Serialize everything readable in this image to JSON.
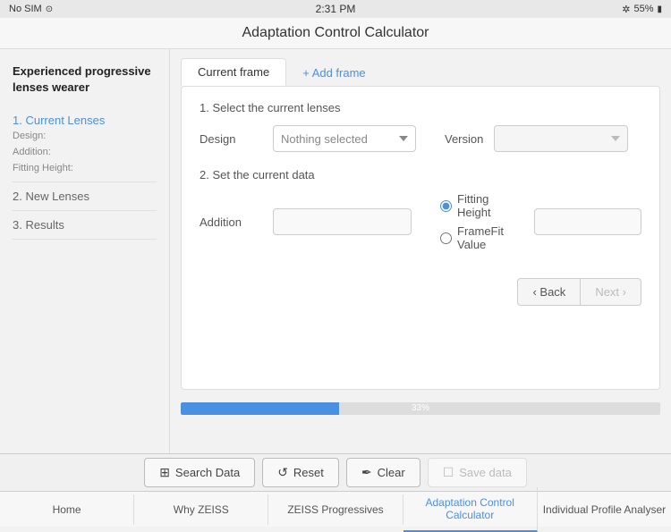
{
  "statusBar": {
    "carrier": "No SIM",
    "time": "2:31 PM",
    "battery": "55%",
    "wifi": true
  },
  "titleBar": {
    "title": "Adaptation Control Calculator"
  },
  "sidebar": {
    "title": "Experienced progressive lenses wearer",
    "items": [
      {
        "id": "current-lenses",
        "number": "1.",
        "label": "Current Lenses",
        "active": true,
        "subItems": [
          {
            "key": "Design:",
            "value": ""
          },
          {
            "key": "Addition:",
            "value": ""
          },
          {
            "key": "Fitting Height:",
            "value": ""
          }
        ]
      },
      {
        "id": "new-lenses",
        "number": "2.",
        "label": "New Lenses",
        "active": false
      },
      {
        "id": "results",
        "number": "3.",
        "label": "Results",
        "active": false
      }
    ]
  },
  "tabs": [
    {
      "label": "Current frame",
      "active": true
    },
    {
      "label": "+ Add frame",
      "active": false
    }
  ],
  "sections": {
    "section1": {
      "title": "1. Select the current lenses",
      "designLabel": "Design",
      "designPlaceholder": "Nothing selected",
      "versionLabel": "Version"
    },
    "section2": {
      "title": "2. Set the current data",
      "additionLabel": "Addition",
      "fittingHeightLabel": "Fitting Height",
      "fittingHeightSelected": true,
      "frameFitLabel": "FrameFit Value",
      "frameFitSelected": false
    }
  },
  "navigation": {
    "backLabel": "◄ Back",
    "nextLabel": "Next ►"
  },
  "progress": {
    "value": 33,
    "label": "33%"
  },
  "toolbar": {
    "searchDataLabel": "Search Data",
    "resetLabel": "Reset",
    "clearLabel": "Clear",
    "saveDataLabel": "Save data"
  },
  "bottomNav": [
    {
      "label": "Home",
      "active": false
    },
    {
      "label": "Why ZEISS",
      "active": false
    },
    {
      "label": "ZEISS Progressives",
      "active": false
    },
    {
      "label": "Adaptation Control Calculator",
      "active": true
    },
    {
      "label": "Individual Profile Analyser",
      "active": false
    }
  ],
  "icons": {
    "search": "⊞",
    "reset": "↺",
    "clear": "✏",
    "save": "💾",
    "back": "‹",
    "next": "›",
    "wifi": "✦",
    "battery": "▮"
  }
}
